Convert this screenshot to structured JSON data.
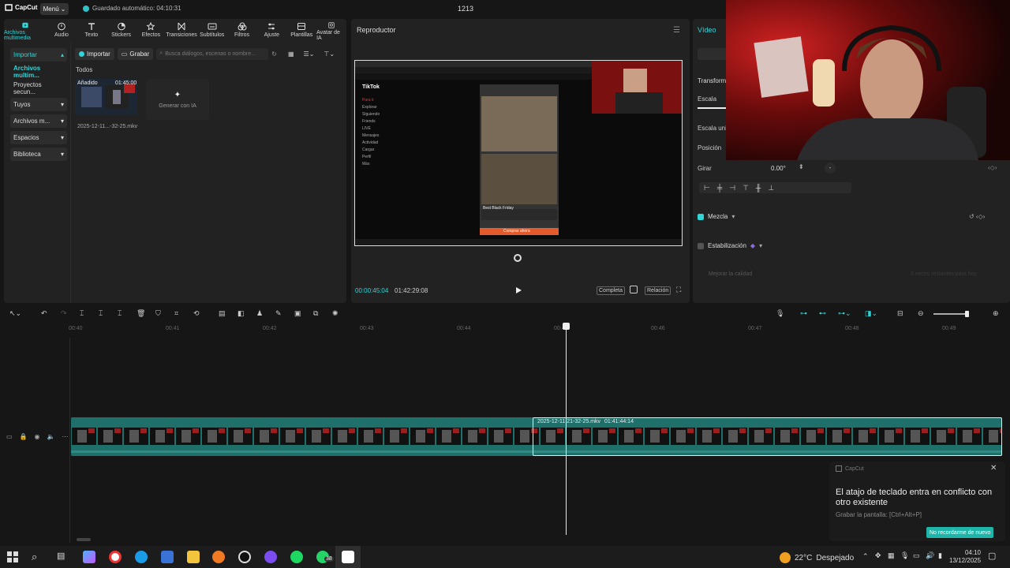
{
  "titlebar": {
    "logo": "CapCut",
    "menu": "Menú",
    "autosave": "Guardado automático: 04:10:31",
    "project_title": "1213"
  },
  "toolbar": {
    "tools": [
      {
        "label": "Archivos multimedia",
        "icon": "media-icon"
      },
      {
        "label": "Audio",
        "icon": "audio-icon"
      },
      {
        "label": "Texto",
        "icon": "text-icon"
      },
      {
        "label": "Stickers",
        "icon": "sticker-icon"
      },
      {
        "label": "Efectos",
        "icon": "effects-icon"
      },
      {
        "label": "Transiciones",
        "icon": "transition-icon"
      },
      {
        "label": "Subtítulos",
        "icon": "subtitles-icon"
      },
      {
        "label": "Filtros",
        "icon": "filters-icon"
      },
      {
        "label": "Ajuste",
        "icon": "adjust-icon"
      },
      {
        "label": "Plantillas",
        "icon": "templates-icon"
      },
      {
        "label": "Avatar de IA",
        "icon": "avatar-icon"
      }
    ]
  },
  "sidebar": {
    "items": [
      {
        "label": "Importar",
        "chevron": "▴"
      },
      {
        "label": "Archivos multim...",
        "chevron": ""
      },
      {
        "label": "Proyectos secun...",
        "chevron": ""
      },
      {
        "label": "Tuyos",
        "chevron": "▾"
      },
      {
        "label": "Archivos m...",
        "chevron": "▾"
      },
      {
        "label": "Espacios",
        "chevron": "▾"
      },
      {
        "label": "Biblioteca",
        "chevron": "▾"
      }
    ]
  },
  "media": {
    "import_label": "Importar",
    "record_label": "Grabar",
    "search_placeholder": "Busca diálogos, escenas o nombre...",
    "all_label": "Todos",
    "clip": {
      "added": "Añadido",
      "duration": "01:45:00",
      "name": "2025-12-11...-32-25.mkv"
    },
    "generate_ai": "Generar con IA"
  },
  "player": {
    "title": "Reproductor",
    "current_time": "00:00:45:04",
    "total_time": "01:42:29:08",
    "full_label": "Completa",
    "ratio_label": "Relación"
  },
  "screen_preview": {
    "tiktok_title": "TikTok",
    "nav": [
      "Para ti",
      "Explorar",
      "Siguiendo",
      "Friends",
      "LIVE",
      "Mensajes",
      "Actividad",
      "Cargar",
      "Perfil",
      "Más"
    ],
    "product_title": "Best Black Friday",
    "buy_button": "Comprar ahora"
  },
  "right_panel": {
    "tab": "Vídeo",
    "transform": "Transformar",
    "scale": "Escala",
    "uniform_scale": "Escala uniforme",
    "position": "Posición",
    "rotate": "Girar",
    "rotate_value": "0.00°",
    "blend": "Mezcla",
    "stabilization": "Estabilización",
    "improve_quality": "Mejorar la calidad",
    "improve_note": "5 veces restantes para hoy"
  },
  "timeline": {
    "ticks": [
      "00:40",
      "00:41",
      "00:42",
      "00:43",
      "00:44",
      "00:45",
      "00:46",
      "00:47",
      "00:48",
      "00:49"
    ],
    "clip_label": "2025-12-11 21-32-25.mkv",
    "clip_duration": "01:41:44:14"
  },
  "toast": {
    "app": "CapCut",
    "title": "El atajo de teclado entra en conflicto con otro existente",
    "subtitle": "Grabar la pantalla: [Ctrl+Alt+P]",
    "button": "No recordarme de nuevo"
  },
  "taskbar": {
    "weather_temp": "22°C",
    "weather_text": "Despejado",
    "time": "04:10",
    "date": "13/12/2025",
    "whatsapp_badge": "38"
  },
  "colors": {
    "accent": "#2fd5d8",
    "track": "#1f6f6a",
    "toast_button": "#1fb5a9"
  }
}
